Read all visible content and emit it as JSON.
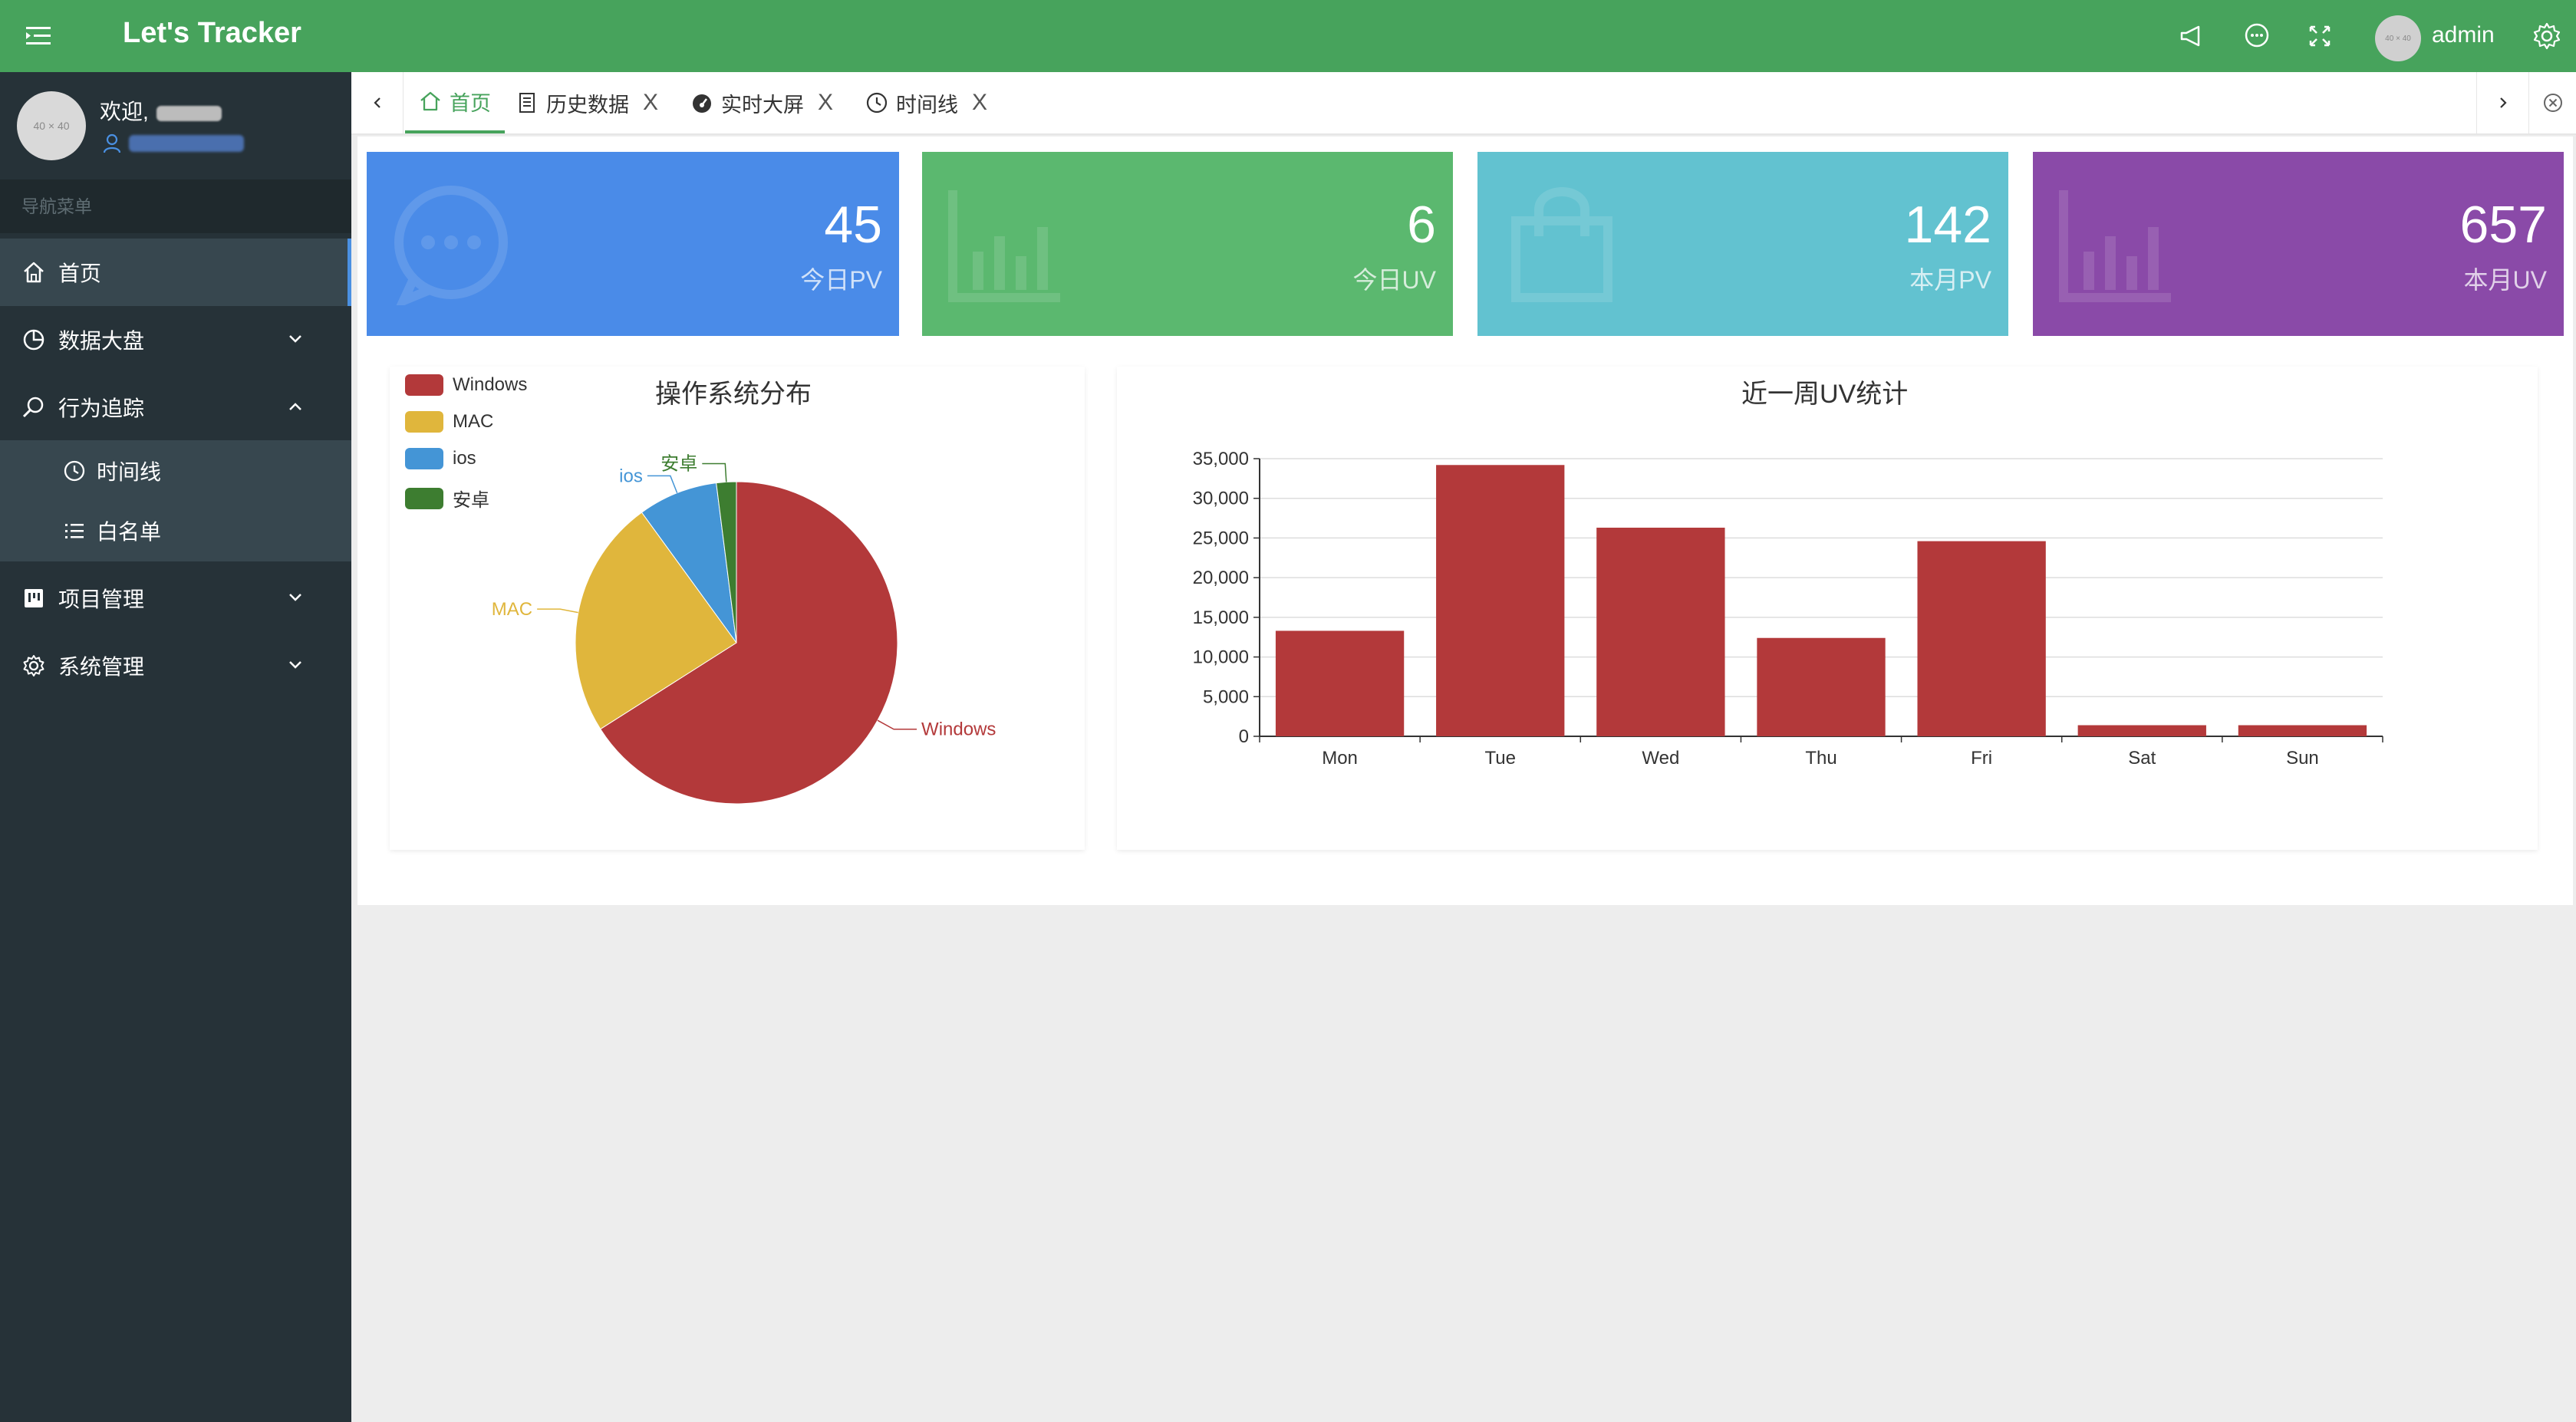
{
  "app": {
    "title": "Let's Tracker",
    "user": "admin",
    "avatar_text": "40 × 40"
  },
  "sidebar": {
    "welcome": "欢迎,",
    "avatar_text": "40 × 40",
    "nav_header": "导航菜单",
    "items": [
      {
        "label": "首页",
        "icon": "home-icon"
      },
      {
        "label": "数据大盘",
        "icon": "pie-chart-icon"
      },
      {
        "label": "行为追踪",
        "icon": "search-icon"
      },
      {
        "label": "项目管理",
        "icon": "board-icon"
      },
      {
        "label": "系统管理",
        "icon": "gear-icon"
      }
    ],
    "subitems": [
      {
        "label": "时间线",
        "icon": "clock-icon"
      },
      {
        "label": "白名单",
        "icon": "list-icon"
      }
    ]
  },
  "tabs": [
    {
      "label": "首页",
      "icon": "home-icon",
      "closable": false
    },
    {
      "label": "历史数据",
      "icon": "document-icon",
      "closable": true
    },
    {
      "label": "实时大屏",
      "icon": "dashboard-icon",
      "closable": true
    },
    {
      "label": "时间线",
      "icon": "clock-icon",
      "closable": true
    }
  ],
  "tab_close_glyph": "X",
  "stats": [
    {
      "value": "45",
      "label": "今日PV",
      "color": "#4a8be8",
      "icon": "chat-icon"
    },
    {
      "value": "6",
      "label": "今日UV",
      "color": "#5bb86f",
      "icon": "bar-chart-icon"
    },
    {
      "value": "142",
      "label": "本月PV",
      "color": "#62c2d0",
      "icon": "shopping-bag-icon"
    },
    {
      "value": "657",
      "label": "本月UV",
      "color": "#8a4aa8",
      "icon": "bar-chart-icon"
    }
  ],
  "chart_data": [
    {
      "type": "pie",
      "title": "操作系统分布",
      "legend_position": "top-left",
      "labels": [
        "Windows",
        "MAC",
        "ios",
        "安卓"
      ],
      "values": [
        66,
        24,
        8,
        2
      ],
      "colors": [
        "#b3393a",
        "#e0b63c",
        "#4495d6",
        "#3d7d30"
      ]
    },
    {
      "type": "bar",
      "title": "近一周UV统计",
      "categories": [
        "Mon",
        "Tue",
        "Wed",
        "Thu",
        "Fri",
        "Sat",
        "Sun"
      ],
      "values": [
        13300,
        34200,
        26300,
        12400,
        24600,
        1400,
        1400
      ],
      "ylim": [
        0,
        35000
      ],
      "yticks": [
        "0",
        "5,000",
        "10,000",
        "15,000",
        "20,000",
        "25,000",
        "30,000",
        "35,000"
      ],
      "grid": true,
      "color": "#b3393a"
    }
  ]
}
